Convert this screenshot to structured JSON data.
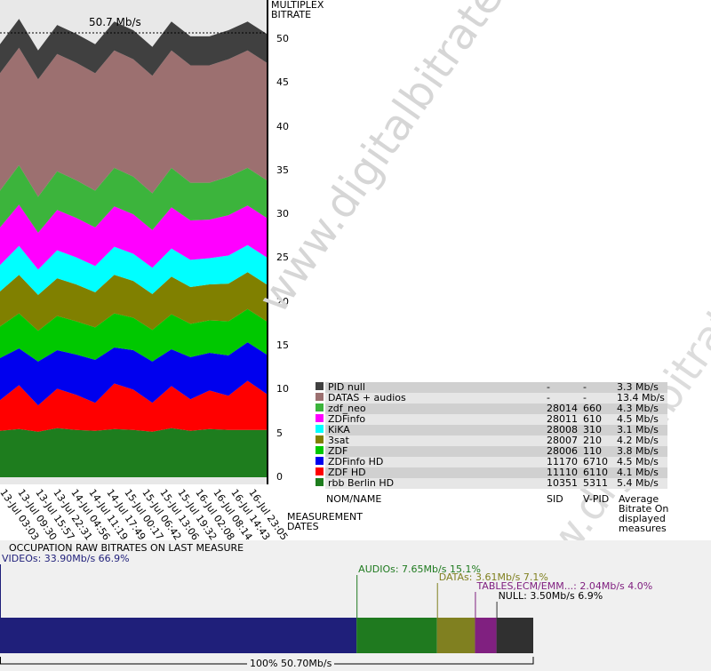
{
  "chart_data": [
    {
      "type": "area",
      "title": "50.7 Mb/s",
      "ylabel": "MULTIPLEX BITRATE",
      "xlabel": "MEASUREMENT DATES",
      "ylim": [
        0,
        50.7
      ],
      "yticks": [
        0,
        5,
        10,
        15,
        20,
        25,
        30,
        35,
        40,
        45,
        50
      ],
      "x_tick_labels": [
        "13-Jul 03:03",
        "13-Jul 09:30",
        "13-Jul 15:57",
        "13-Jul 22:31",
        "14-Jul 04:56",
        "14-Jul 11:19",
        "14-Jul 17:49",
        "15-Jul 00:17",
        "15-Jul 06:42",
        "15-Jul 13:06",
        "15-Jul 19:32",
        "16-Jul 02:08",
        "16-Jul 08:14",
        "16-Jul 14:43",
        "16-Jul 23:05"
      ],
      "series": [
        {
          "name": "rbb Berlin HD",
          "color": "#1e7d1e",
          "values": [
            5.3,
            5.5,
            5.2,
            5.6,
            5.4,
            5.3,
            5.5,
            5.4,
            5.2,
            5.6,
            5.3,
            5.5,
            5.4,
            5.4,
            5.4
          ]
        },
        {
          "name": "ZDF HD",
          "color": "#ff0000",
          "values": [
            3.5,
            5.0,
            3.0,
            4.5,
            4.0,
            3.2,
            5.2,
            4.6,
            3.3,
            4.8,
            3.6,
            4.4,
            3.9,
            5.6,
            4.1
          ]
        },
        {
          "name": "ZDFinfo HD",
          "color": "#0000ee",
          "values": [
            4.8,
            4.2,
            5.0,
            4.4,
            4.6,
            4.9,
            4.1,
            4.5,
            4.7,
            4.2,
            4.8,
            4.3,
            4.6,
            4.4,
            4.5
          ]
        },
        {
          "name": "ZDF",
          "color": "#00c800",
          "values": [
            3.6,
            4.0,
            3.5,
            3.9,
            3.8,
            3.7,
            3.9,
            3.7,
            3.6,
            4.0,
            3.8,
            3.7,
            3.9,
            3.8,
            3.8
          ]
        },
        {
          "name": "3sat",
          "color": "#808000",
          "values": [
            4.0,
            4.4,
            4.1,
            4.3,
            4.2,
            4.0,
            4.4,
            4.2,
            4.1,
            4.3,
            4.2,
            4.1,
            4.3,
            4.2,
            4.2
          ]
        },
        {
          "name": "KiKA",
          "color": "#00ffff",
          "values": [
            3.0,
            3.3,
            2.9,
            3.2,
            3.1,
            3.0,
            3.2,
            3.1,
            3.0,
            3.2,
            3.1,
            3.0,
            3.2,
            3.1,
            3.1
          ]
        },
        {
          "name": "ZDFinfo",
          "color": "#ff00ff",
          "values": [
            4.3,
            4.7,
            4.2,
            4.6,
            4.5,
            4.4,
            4.6,
            4.5,
            4.3,
            4.7,
            4.5,
            4.4,
            4.6,
            4.5,
            4.5
          ]
        },
        {
          "name": "zdf_neo",
          "color": "#3cb43c",
          "values": [
            4.2,
            4.5,
            4.1,
            4.4,
            4.3,
            4.2,
            4.4,
            4.3,
            4.2,
            4.5,
            4.3,
            4.2,
            4.4,
            4.3,
            4.3
          ]
        },
        {
          "name": "DATAS + audios",
          "color": "#9c7070",
          "values": [
            13.4,
            13.4,
            13.4,
            13.4,
            13.4,
            13.4,
            13.4,
            13.4,
            13.4,
            13.4,
            13.4,
            13.4,
            13.4,
            13.4,
            13.4
          ]
        },
        {
          "name": "PID null",
          "color": "#404040",
          "values": [
            3.3,
            3.3,
            3.3,
            3.3,
            3.3,
            3.3,
            3.3,
            3.3,
            3.3,
            3.3,
            3.3,
            3.3,
            3.3,
            3.3,
            3.3
          ]
        }
      ]
    },
    {
      "type": "bar",
      "title": "OCCUPATION RAW BITRATES ON LAST MEASURE",
      "total_label": "100%  50.70Mb/s",
      "segments": [
        {
          "label": "VIDEOs: 33.90Mb/s  66.9%",
          "value": 33.9,
          "color": "#1f1f7a",
          "text_color": "#1f1f7a"
        },
        {
          "label": "AUDIOs: 7.65Mb/s  15.1%",
          "value": 7.65,
          "color": "#1f7a1f",
          "text_color": "#1f7a1f"
        },
        {
          "label": "DATAs: 3.61Mb/s  7.1%",
          "value": 3.61,
          "color": "#808020",
          "text_color": "#808020"
        },
        {
          "label": "TABLES,ECM/EMM...: 2.04Mb/s  4.0%",
          "value": 2.04,
          "color": "#802080",
          "text_color": "#802080"
        },
        {
          "label": "NULL: 3.50Mb/s  6.9%",
          "value": 3.5,
          "color": "#303030",
          "text_color": "#000000"
        }
      ]
    }
  ],
  "legend": {
    "rows": [
      {
        "name": "PID null",
        "sid": "-",
        "vpid": "-",
        "avg": "3.3 Mb/s",
        "color": "#404040"
      },
      {
        "name": "DATAS + audios",
        "sid": "-",
        "vpid": "-",
        "avg": "13.4 Mb/s",
        "color": "#9c7070"
      },
      {
        "name": "zdf_neo",
        "sid": "28014",
        "vpid": "660",
        "avg": "4.3 Mb/s",
        "color": "#3cb43c"
      },
      {
        "name": "ZDFinfo",
        "sid": "28011",
        "vpid": "610",
        "avg": "4.5 Mb/s",
        "color": "#ff00ff"
      },
      {
        "name": "KiKA",
        "sid": "28008",
        "vpid": "310",
        "avg": "3.1 Mb/s",
        "color": "#00ffff"
      },
      {
        "name": "3sat",
        "sid": "28007",
        "vpid": "210",
        "avg": "4.2 Mb/s",
        "color": "#808000"
      },
      {
        "name": "ZDF",
        "sid": "28006",
        "vpid": "110",
        "avg": "3.8 Mb/s",
        "color": "#00c800"
      },
      {
        "name": "ZDFinfo HD",
        "sid": "11170",
        "vpid": "6710",
        "avg": "4.5 Mb/s",
        "color": "#0000ee"
      },
      {
        "name": "ZDF HD",
        "sid": "11110",
        "vpid": "6110",
        "avg": "4.1 Mb/s",
        "color": "#ff0000"
      },
      {
        "name": "rbb Berlin HD",
        "sid": "10351",
        "vpid": "5311",
        "avg": "5.4 Mb/s",
        "color": "#1e7d1e"
      }
    ],
    "col_name": "NOM/NAME",
    "col_sid": "SID",
    "col_vpid": "V-PID",
    "col_avg": "Average Bitrate On displayed measures"
  },
  "watermark": "www.digitalbitrate.com"
}
